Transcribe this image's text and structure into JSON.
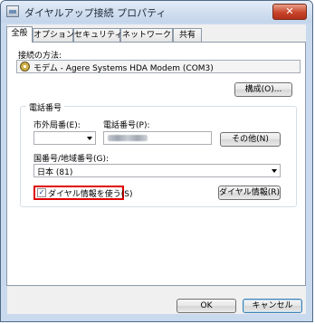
{
  "window": {
    "title": "ダイヤルアップ接続 プロパティ",
    "close_label": "✕"
  },
  "tabs": [
    {
      "label": "全般"
    },
    {
      "label": "オプション"
    },
    {
      "label": "セキュリティ"
    },
    {
      "label": "ネットワーク"
    },
    {
      "label": "共有"
    }
  ],
  "connection": {
    "method_label": "接続の方法:",
    "device": "モデム - Agere Systems HDA Modem (COM3)",
    "configure_button": "構成(O)..."
  },
  "phone": {
    "group_title": "電話番号",
    "area_code_label": "市外局番(E):",
    "area_code_value": "",
    "phone_number_label": "電話番号(P):",
    "other_button": "その他(N)",
    "country_label": "国番号/地域番号(G):",
    "country_value": "日本 (81)",
    "use_dialing_rules_label": "ダイヤル情報を使う(S)",
    "use_dialing_rules_checked": true,
    "dialing_rules_button": "ダイヤル情報(R)"
  },
  "footer": {
    "ok_button": "OK",
    "cancel_button": "キャンセル"
  }
}
